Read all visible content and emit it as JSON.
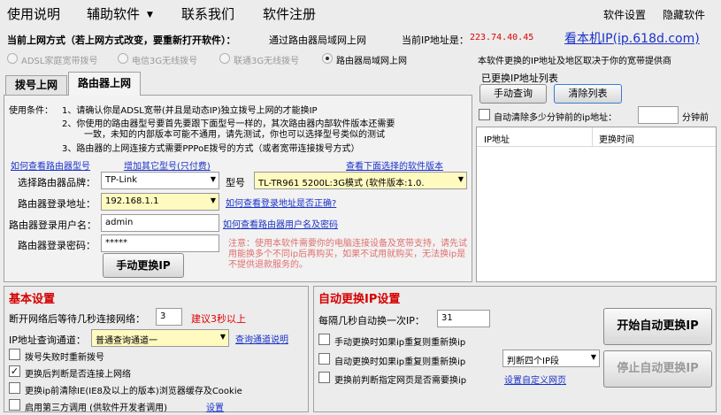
{
  "menu": {
    "usage": "使用说明",
    "aux": "辅助软件",
    "contact": "联系我们",
    "register": "软件注册",
    "settings": "软件设置",
    "hide": "隐藏软件"
  },
  "net": {
    "current_label": "当前上网方式（若上网方式改变，要重新打开软件）：",
    "current_value": "通过路由器局域网上网",
    "ip_label": "当前IP地址是：",
    "ip_value": "223.74.40.45",
    "view_ip_link": "看本机IP(ip.618d.com)",
    "radio_adsl": "ADSL家庭宽带拨号",
    "radio_telecom": "电信3G无线拨号",
    "radio_unicom": "联通3G无线拨号",
    "radio_router": "路由器局域网上网",
    "right_note": "本软件更换的IP地址及地区取决于你的宽带提供商"
  },
  "tabs": {
    "dial": "拨号上网",
    "router": "路由器上网"
  },
  "conditions": {
    "label": "使用条件：",
    "line1": "1、请确认你是ADSL宽带(并且是动态IP)独立拨号上网的才能换IP",
    "line2a": "2、你使用的路由器型号要首先要跟下面型号一样的，其次路由器内部软件版本还需要",
    "line2b": "一致，未知的内部版本可能不通用，请先测试，你也可以选择型号类似的测试",
    "line3": "3、路由器的上网连接方式需要PPPoE拨号的方式（或者宽带连接拨号方式）"
  },
  "router": {
    "link_check_model": "如何查看路由器型号",
    "link_add_model": "增加其它型号(只付费)",
    "link_view_version": "查看下面选择的软件版本",
    "brand_label": "选择路由器品牌：",
    "brand_value": "TP-Link",
    "model_label": "型号",
    "model_value": "TL-TR961 5200L:3G模式 (软件版本:1.0.",
    "addr_label": "路由器登录地址：",
    "addr_value": "192.168.1.1",
    "link_addr_check": "如何查看登录地址是否正确?",
    "user_label": "路由器登录用户名：",
    "user_value": "admin",
    "link_user_pwd": "如何查看路由器用户名及密码",
    "pwd_label": "路由器登录密码：",
    "pwd_value": "*****",
    "manual_btn": "手动更换IP",
    "notice": "注意：使用本软件需要你的电脑连接设备及宽带支持，请先试用能换多个不同ip后再购买，如果不试用就购买，无法换ip是不提供退款服务的。"
  },
  "iplist": {
    "title": "已更换IP地址列表",
    "query_btn": "手动查询",
    "clear_btn": "清除列表",
    "auto_clear_label": "自动清除多少分钟前的ip地址：",
    "auto_clear_unit": "分钟前",
    "col_ip": "IP地址",
    "col_time": "更换时间"
  },
  "basic": {
    "title": "基本设置",
    "wait_label": "断开网络后等待几秒连接网络：",
    "wait_value": "3",
    "wait_hint": "建议3秒以上",
    "channel_label": "IP地址查询通道：",
    "channel_value": "普通查询通道一",
    "link_channel": "查询通道说明",
    "chk_redial": "拨号失败时重新拨号",
    "chk_disconnect": "更换后判断是否连接上网络",
    "chk_cache": "更换ip前清除IE(IE8及以上的版本)浏览器缓存及Cookie",
    "chk_thirdparty": "启用第三方调用 (供软件开发者调用)",
    "link_settings": "设置"
  },
  "auto": {
    "title": "自动更换IP设置",
    "interval_label": "每隔几秒自动换一次IP：",
    "interval_value": "31",
    "chk_manual_dup": "手动更换时如果ip重复则重新换ip",
    "chk_auto_dup": "自动更换时如果ip重复则重新换ip",
    "segment_value": "判断四个IP段",
    "chk_page": "更换前判断指定网页是否需要换ip",
    "link_custom_page": "设置自定义网页",
    "start_btn": "开始自动更换IP",
    "stop_btn": "停止自动更换IP"
  }
}
